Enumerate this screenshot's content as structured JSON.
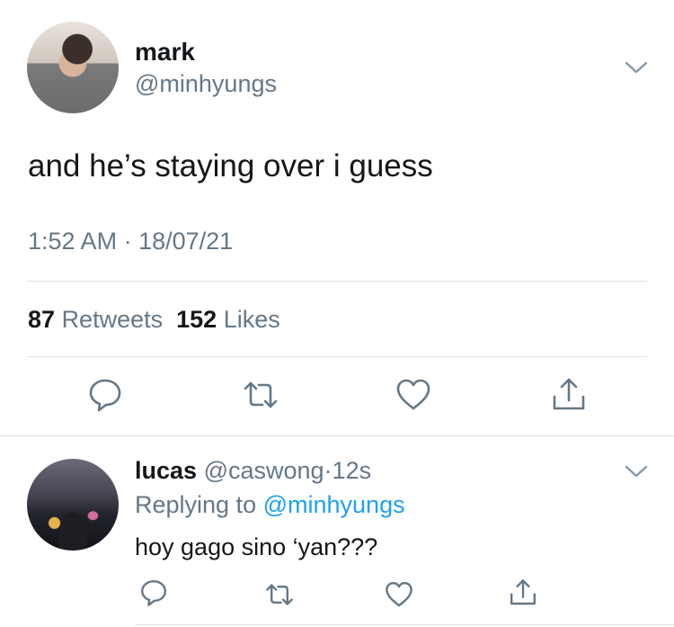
{
  "tweet": {
    "author_name": "mark",
    "author_handle": "@minhyungs",
    "text": "and he’s staying over i guess",
    "time": "1:52 AM",
    "dot": "·",
    "date": "18/07/21",
    "retweets_count": "87",
    "retweets_label": "Retweets",
    "likes_count": "152",
    "likes_label": "Likes"
  },
  "reply": {
    "author_name": "lucas",
    "author_handle": "@caswong",
    "dot": "·",
    "age": "12s",
    "replying_label": "Replying to",
    "replying_handle": "@minhyungs",
    "text": "hoy gago sino ‘yan???"
  },
  "icons": {
    "reply": "speech-bubble-icon",
    "retweet": "retweet-icon",
    "like": "heart-icon",
    "share": "share-icon",
    "menu": "chevron-down-icon"
  },
  "colors": {
    "text": "#14171a",
    "secondary": "#657786",
    "link": "#1da1f2",
    "divider": "#dde2e6"
  }
}
